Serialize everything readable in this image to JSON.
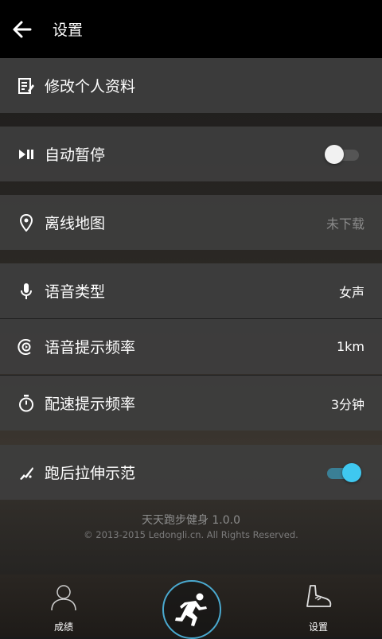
{
  "header": {
    "title": "设置"
  },
  "settings": {
    "edit_profile": {
      "label": "修改个人资料"
    },
    "auto_pause": {
      "label": "自动暂停",
      "enabled": false
    },
    "offline_map": {
      "label": "离线地图",
      "value": "未下载"
    },
    "voice_type": {
      "label": "语音类型",
      "value": "女声"
    },
    "voice_frequency": {
      "label": "语音提示频率",
      "value": "1km"
    },
    "pace_frequency": {
      "label": "配速提示频率",
      "value": "3分钟"
    },
    "stretch_demo": {
      "label": "跑后拉伸示范",
      "enabled": true
    }
  },
  "footer": {
    "app_version": "天天跑步健身 1.0.0",
    "copyright": "© 2013-2015 Ledongli.cn. All Rights Reserved."
  },
  "tabbar": {
    "left_label": "成绩",
    "right_label": "设置"
  },
  "colors": {
    "accent": "#3fc8f0",
    "row_bg": "#3e3e3e",
    "appbar_bg": "#000000"
  }
}
